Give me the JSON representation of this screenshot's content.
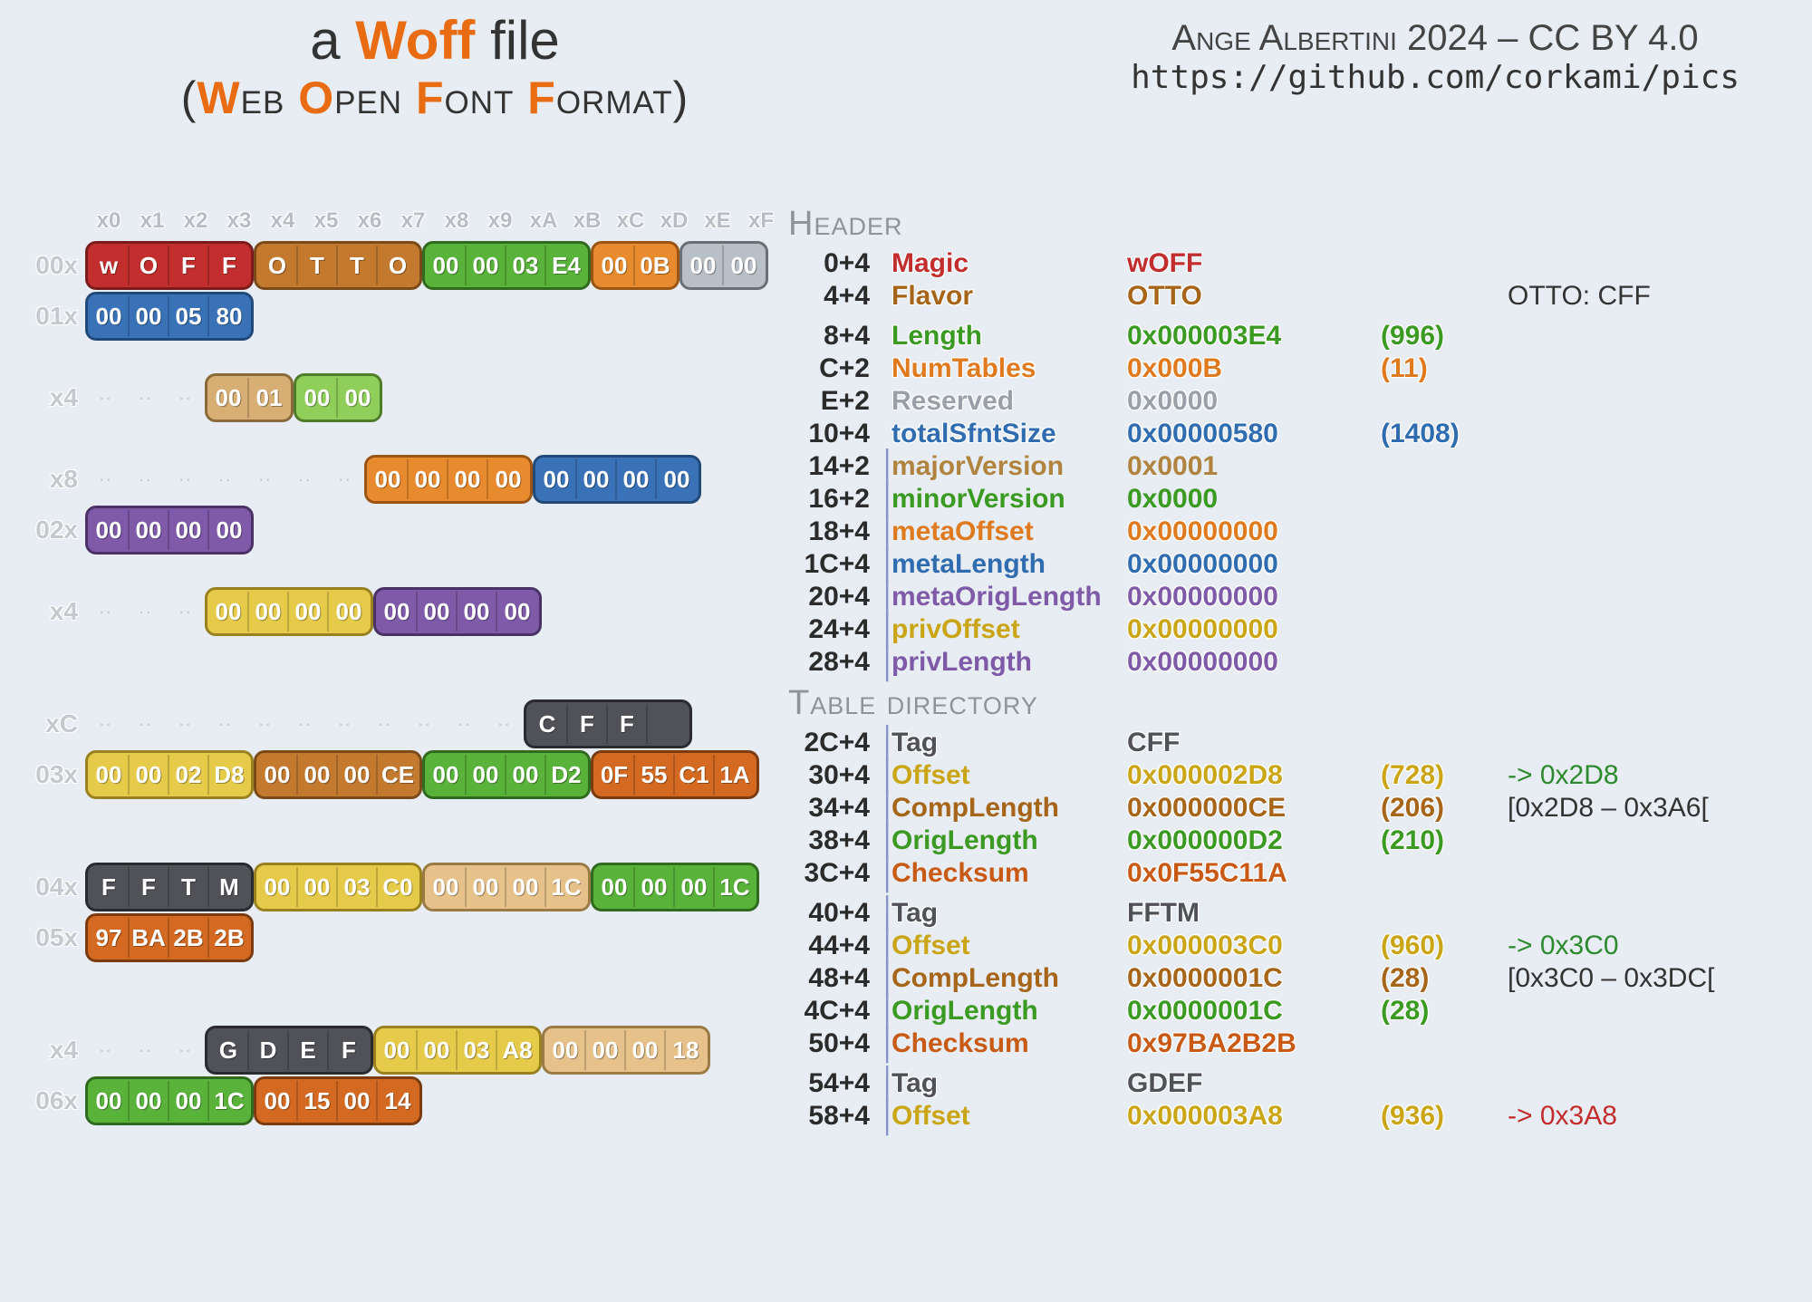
{
  "title": {
    "line1_pre": "a ",
    "line1_hl": "Woff",
    "line1_post": " file",
    "line2": "Web Open Font Format",
    "line2_letters": [
      "W",
      "O",
      "F",
      "F"
    ]
  },
  "attribution": {
    "credit": "Ange Albertini 2024 – CC BY 4.0",
    "url": "https://github.com/corkami/pics"
  },
  "hex": {
    "col_headers": [
      "x0",
      "x1",
      "x2",
      "x3",
      "x4",
      "x5",
      "x6",
      "x7",
      "x8",
      "x9",
      "xA",
      "xB",
      "xC",
      "xD",
      "xE",
      "xF"
    ],
    "rows": [
      {
        "label": "00x",
        "segs": [
          {
            "color": "red",
            "cells": [
              "w",
              "O",
              "F",
              "F"
            ]
          },
          {
            "color": "brown",
            "cells": [
              "O",
              "T",
              "T",
              "O"
            ]
          },
          {
            "color": "green",
            "cells": [
              "00",
              "00",
              "03",
              "E4"
            ]
          },
          {
            "color": "orange",
            "cells": [
              "00",
              "0B"
            ]
          },
          {
            "color": "gray",
            "cells": [
              "00",
              "00"
            ]
          }
        ]
      },
      {
        "label": "01x",
        "segs": [
          {
            "color": "blue",
            "cells": [
              "00",
              "00",
              "05",
              "80"
            ]
          }
        ]
      },
      {
        "gap": true
      },
      {
        "label": "x4",
        "dots": 3,
        "segs": [
          {
            "color": "tan",
            "cells": [
              "00",
              "01"
            ]
          },
          {
            "color": "lgreen",
            "cells": [
              "00",
              "00"
            ]
          }
        ]
      },
      {
        "gap": true
      },
      {
        "label": "x8",
        "dots": 7,
        "segs": [
          {
            "color": "orange",
            "cells": [
              "00",
              "00",
              "00",
              "00"
            ]
          },
          {
            "color": "blue",
            "cells": [
              "00",
              "00",
              "00",
              "00"
            ]
          }
        ]
      },
      {
        "label": "02x",
        "segs": [
          {
            "color": "purple",
            "cells": [
              "00",
              "00",
              "00",
              "00"
            ]
          }
        ]
      },
      {
        "gap": true
      },
      {
        "label": "x4",
        "dots": 3,
        "segs": [
          {
            "color": "yellow",
            "cells": [
              "00",
              "00",
              "00",
              "00"
            ]
          },
          {
            "color": "purple",
            "cells": [
              "00",
              "00",
              "00",
              "00"
            ]
          }
        ]
      },
      {
        "gap": true
      },
      {
        "gap": true
      },
      {
        "label": "xC",
        "dots": 11,
        "segs": [
          {
            "color": "dgray",
            "cells": [
              "C",
              "F",
              "F",
              " "
            ]
          }
        ]
      },
      {
        "label": "03x",
        "segs": [
          {
            "color": "yellow",
            "cells": [
              "00",
              "00",
              "02",
              "D8"
            ]
          },
          {
            "color": "brown",
            "cells": [
              "00",
              "00",
              "00",
              "CE"
            ]
          },
          {
            "color": "green",
            "cells": [
              "00",
              "00",
              "00",
              "D2"
            ]
          },
          {
            "color": "dorange",
            "cells": [
              "0F",
              "55",
              "C1",
              "1A"
            ]
          }
        ]
      },
      {
        "gap": true
      },
      {
        "gap": true
      },
      {
        "label": "04x",
        "segs": [
          {
            "color": "dgray",
            "cells": [
              "F",
              "F",
              "T",
              "M"
            ]
          },
          {
            "color": "yellow",
            "cells": [
              "00",
              "00",
              "03",
              "C0"
            ]
          },
          {
            "color": "tan2",
            "cells": [
              "00",
              "00",
              "00",
              "1C"
            ]
          },
          {
            "color": "green",
            "cells": [
              "00",
              "00",
              "00",
              "1C"
            ]
          }
        ]
      },
      {
        "label": "05x",
        "segs": [
          {
            "color": "dorange",
            "cells": [
              "97",
              "BA",
              "2B",
              "2B"
            ]
          }
        ]
      },
      {
        "gap": true
      },
      {
        "gap": true
      },
      {
        "label": "x4",
        "dots": 3,
        "segs": [
          {
            "color": "dgray",
            "cells": [
              "G",
              "D",
              "E",
              "F"
            ]
          },
          {
            "color": "yellow",
            "cells": [
              "00",
              "00",
              "03",
              "A8"
            ]
          },
          {
            "color": "tan2",
            "cells": [
              "00",
              "00",
              "00",
              "18"
            ]
          }
        ]
      },
      {
        "label": "06x",
        "segs": [
          {
            "color": "green",
            "cells": [
              "00",
              "00",
              "00",
              "1C"
            ]
          },
          {
            "color": "dorange",
            "cells": [
              "00",
              "15",
              "00",
              "14"
            ]
          }
        ]
      }
    ]
  },
  "desc": [
    {
      "section": "Header"
    },
    {
      "off": "0+4",
      "bar": false,
      "name": "Magic",
      "nclass": "t-red o",
      "val": "wOFF",
      "vclass": "t-red o"
    },
    {
      "off": "4+4",
      "bar": false,
      "name": "Flavor",
      "nclass": "t-brown o",
      "val": "OTTO",
      "vclass": "t-brown o",
      "note": "OTTO: CFF"
    },
    {
      "spacer": true
    },
    {
      "off": "8+4",
      "bar": false,
      "name": "Length",
      "nclass": "t-green o",
      "val": "0x000003E4",
      "vclass": "t-green o",
      "dec": "(996)",
      "dclass": "t-green o"
    },
    {
      "off": "C+2",
      "bar": false,
      "name": "NumTables",
      "nclass": "t-orange o",
      "val": "0x000B",
      "vclass": "t-orange o",
      "dec": "(11)",
      "dclass": "t-orange o"
    },
    {
      "off": "E+2",
      "bar": false,
      "name": "Reserved",
      "nclass": "t-gray o",
      "val": "0x0000",
      "vclass": "t-gray o"
    },
    {
      "off": "10+4",
      "bar": false,
      "name": "totalSfntSize",
      "nclass": "t-blue o",
      "val": "0x00000580",
      "vclass": "t-blue o",
      "dec": "(1408)",
      "dclass": "t-blue o"
    },
    {
      "off": "14+2",
      "bar": true,
      "name": "majorVersion",
      "nclass": "t-tan",
      "val": "0x0001",
      "vclass": "t-tan"
    },
    {
      "off": "16+2",
      "bar": true,
      "name": "minorVersion",
      "nclass": "t-green",
      "val": "0x0000",
      "vclass": "t-green"
    },
    {
      "off": "18+4",
      "bar": true,
      "name": "metaOffset",
      "nclass": "t-orange",
      "val": "0x00000000",
      "vclass": "t-orange o"
    },
    {
      "off": "1C+4",
      "bar": true,
      "name": "metaLength",
      "nclass": "t-blue",
      "val": "0x00000000",
      "vclass": "t-blue o"
    },
    {
      "off": "20+4",
      "bar": true,
      "name": "metaOrigLength",
      "nclass": "t-purple",
      "val": "0x00000000",
      "vclass": "t-purple o"
    },
    {
      "off": "24+4",
      "bar": true,
      "name": "privOffset",
      "nclass": "t-yellow",
      "val": "0x00000000",
      "vclass": "t-yellow o"
    },
    {
      "off": "28+4",
      "bar": true,
      "name": "privLength",
      "nclass": "t-purple",
      "val": "0x00000000",
      "vclass": "t-purple o"
    },
    {
      "section": "Table directory"
    },
    {
      "off": "2C+4",
      "bar": true,
      "name": "Tag",
      "nclass": "t-dgray o",
      "val": "CFF",
      "vclass": "t-dgray o"
    },
    {
      "off": "30+4",
      "bar": true,
      "name": "Offset",
      "nclass": "t-yellow",
      "val": "0x000002D8",
      "vclass": "t-yellow o",
      "dec": "(728)",
      "dclass": "t-yellow o",
      "note": "-> 0x2D8",
      "noteclass": "t-greenN"
    },
    {
      "off": "34+4",
      "bar": true,
      "name": "CompLength",
      "nclass": "t-brown",
      "val": "0x000000CE",
      "vclass": "t-brown o",
      "dec": "(206)",
      "dclass": "t-brown o",
      "note": "[0x2D8 – 0x3A6[",
      "noteclass": "t-plain"
    },
    {
      "off": "38+4",
      "bar": true,
      "name": "OrigLength",
      "nclass": "t-green",
      "val": "0x000000D2",
      "vclass": "t-green o",
      "dec": "(210)",
      "dclass": "t-green o"
    },
    {
      "off": "3C+4",
      "bar": true,
      "name": "Checksum",
      "nclass": "t-dorange",
      "val": "0x0F55C11A",
      "vclass": "t-dorange o"
    },
    {
      "spacer": true
    },
    {
      "off": "40+4",
      "bar": true,
      "name": "Tag",
      "nclass": "t-dgray o",
      "val": "FFTM",
      "vclass": "t-dgray o"
    },
    {
      "off": "44+4",
      "bar": true,
      "name": "Offset",
      "nclass": "t-yellow",
      "val": "0x000003C0",
      "vclass": "t-yellow o",
      "dec": "(960)",
      "dclass": "t-yellow o",
      "note": "-> 0x3C0",
      "noteclass": "t-greenN"
    },
    {
      "off": "48+4",
      "bar": true,
      "name": "CompLength",
      "nclass": "t-brown",
      "val": "0x0000001C",
      "vclass": "t-brown o",
      "dec": "(28)",
      "dclass": "t-brown o",
      "note": "[0x3C0 – 0x3DC[",
      "noteclass": "t-plain"
    },
    {
      "off": "4C+4",
      "bar": true,
      "name": "OrigLength",
      "nclass": "t-green",
      "val": "0x0000001C",
      "vclass": "t-green o",
      "dec": "(28)",
      "dclass": "t-green o"
    },
    {
      "off": "50+4",
      "bar": true,
      "name": "Checksum",
      "nclass": "t-dorange",
      "val": "0x97BA2B2B",
      "vclass": "t-dorange o"
    },
    {
      "spacer": true
    },
    {
      "off": "54+4",
      "bar": true,
      "name": "Tag",
      "nclass": "t-dgray o",
      "val": "GDEF",
      "vclass": "t-dgray o"
    },
    {
      "off": "58+4",
      "bar": true,
      "name": "Offset",
      "nclass": "t-yellow",
      "val": "0x000003A8",
      "vclass": "t-yellow o",
      "dec": "(936)",
      "dclass": "t-yellow o",
      "note": "-> 0x3A8",
      "noteclass": "t-redN"
    }
  ]
}
